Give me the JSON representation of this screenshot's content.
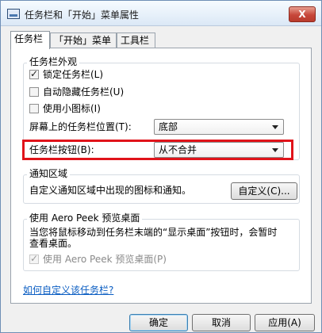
{
  "window": {
    "title": "任务栏和「开始」菜单属性",
    "close_symbol": "X"
  },
  "tabs": [
    {
      "label": "任务栏"
    },
    {
      "label": "「开始」菜单"
    },
    {
      "label": "工具栏"
    }
  ],
  "appearance": {
    "title": "任务栏外观",
    "checks": [
      {
        "label": "锁定任务栏(L)",
        "checked": true
      },
      {
        "label": "自动隐藏任务栏(U)",
        "checked": false
      },
      {
        "label": "使用小图标(I)",
        "checked": false
      }
    ],
    "location_label": "屏幕上的任务栏位置(T):",
    "location_value": "底部",
    "buttons_label": "任务栏按钮(B):",
    "buttons_value": "从不合并"
  },
  "notification": {
    "title": "通知区域",
    "text": "自定义通知区域中出现的图标和通知。",
    "customize_button": "自定义(C)..."
  },
  "peek": {
    "title": "使用 Aero Peek 预览桌面",
    "desc_line1": "当您将鼠标移动到任务栏末端的“显示桌面”按钮时，会暂时",
    "desc_line2": "查看桌面。",
    "check_label": "使用 Aero Peek 预览桌面(P)",
    "checked": true
  },
  "help_link": "如何自定义该任务栏?",
  "footer": {
    "ok": "确定",
    "cancel": "取消",
    "apply": "应用(A)"
  },
  "colors": {
    "highlight": "#e0131a",
    "link": "#0a5dc2"
  }
}
